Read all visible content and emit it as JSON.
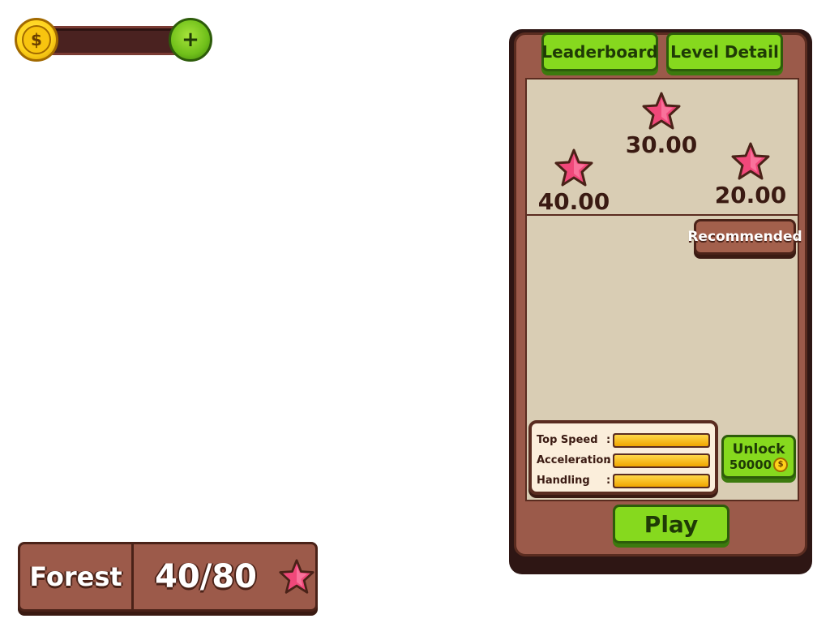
{
  "wallet": {
    "coin_symbol": "$",
    "add_symbol": "+"
  },
  "level_info": {
    "name": "Forest",
    "score": "40/80"
  },
  "panel": {
    "tabs": {
      "leaderboard": "Leaderboard",
      "level_detail": "Level Detail"
    },
    "stars": [
      {
        "value": "40.00"
      },
      {
        "value": "30.00"
      },
      {
        "value": "20.00"
      }
    ],
    "recommended_label": "Recommended",
    "stats": [
      {
        "label": "Top Speed",
        "colon": ":",
        "level": 1.0
      },
      {
        "label": "Acceleration",
        "colon": ":",
        "level": 1.0
      },
      {
        "label": "Handling",
        "colon": ":",
        "level": 1.0
      }
    ],
    "unlock": {
      "label": "Unlock",
      "cost": "50000",
      "coin_symbol": "$"
    },
    "play_label": "Play"
  },
  "colors": {
    "panel_brown": "#9b5a4a",
    "panel_dark": "#2e1614",
    "button_green": "#86d91e",
    "star_pink": "#f0487a",
    "coin_gold": "#ffd21a",
    "paper": "#d9cdb4"
  }
}
